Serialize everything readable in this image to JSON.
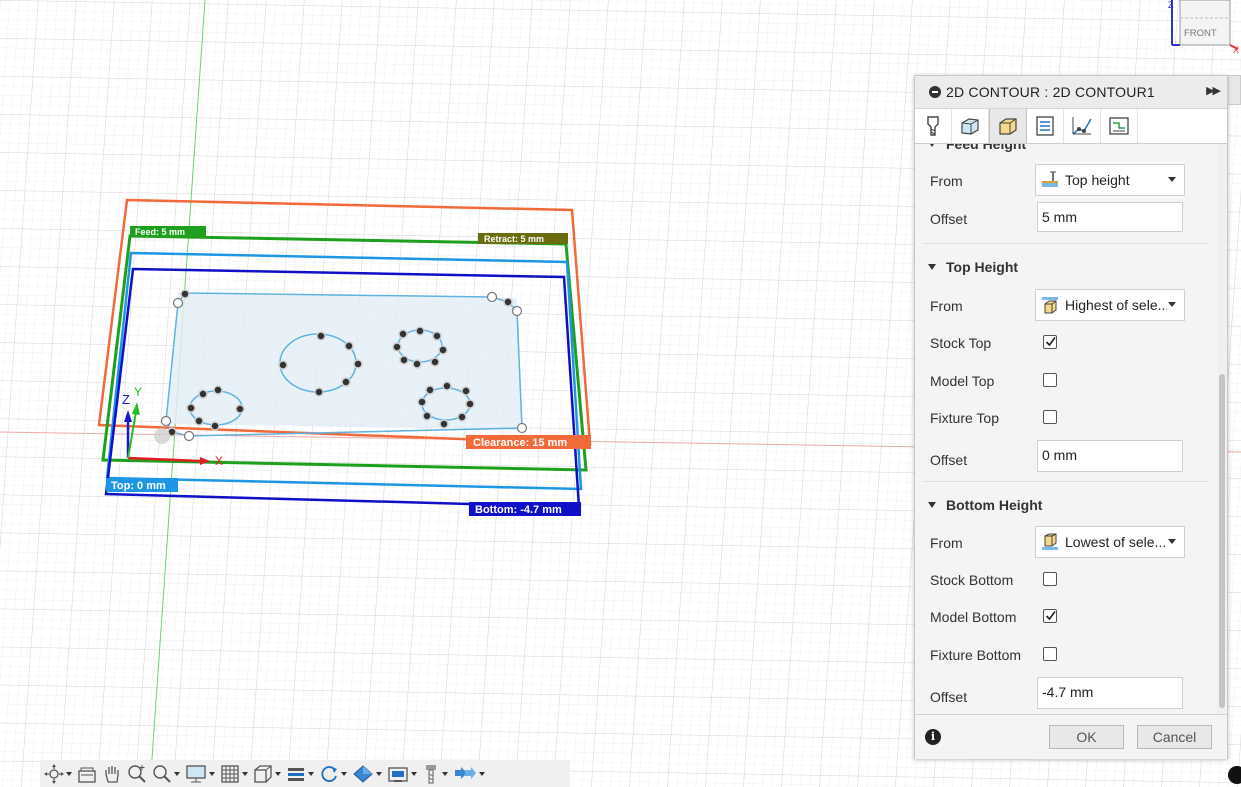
{
  "viewport": {
    "labels": {
      "feed": "Feed: 5 mm",
      "retract": "Retract: 5 mm",
      "clearance": "Clearance: 15 mm",
      "top": "Top: 0 mm",
      "bottom": "Bottom: -4.7 mm"
    },
    "axes": {
      "x": "X",
      "y": "Y",
      "z": "Z"
    },
    "colors": {
      "clearance": "#f26a3a",
      "feed": "#1ea01e",
      "retract": "#6b6b10",
      "top": "#1e96e6",
      "bottom": "#1010c8",
      "stock": "#7abde0"
    }
  },
  "viewcube": {
    "face": "FRONT",
    "axis_x": "X",
    "axis_z": "Z"
  },
  "panel": {
    "title": "2D CONTOUR : 2D CONTOUR1",
    "tabs": [
      {
        "name": "tool-tab",
        "icon": "tool-icon"
      },
      {
        "name": "geometry-tab",
        "icon": "geometry-icon"
      },
      {
        "name": "heights-tab",
        "icon": "heights-icon",
        "active": true
      },
      {
        "name": "passes-tab",
        "icon": "passes-icon"
      },
      {
        "name": "linking-tab",
        "icon": "linking-icon"
      },
      {
        "name": "shaft-tab",
        "icon": "shaft-holder-icon"
      }
    ],
    "feed_height": {
      "title": "Feed Height",
      "from_label": "From",
      "from_value": "Top height",
      "offset_label": "Offset",
      "offset_value": "5 mm"
    },
    "top_height": {
      "title": "Top Height",
      "from_label": "From",
      "from_value": "Highest of sele...",
      "stock_top_label": "Stock Top",
      "stock_top": true,
      "model_top_label": "Model Top",
      "model_top": false,
      "fixture_top_label": "Fixture Top",
      "fixture_top": false,
      "offset_label": "Offset",
      "offset_value": "0 mm"
    },
    "bottom_height": {
      "title": "Bottom Height",
      "from_label": "From",
      "from_value": "Lowest of sele...",
      "stock_bottom_label": "Stock Bottom",
      "stock_bottom": false,
      "model_bottom_label": "Model Bottom",
      "model_bottom": true,
      "fixture_bottom_label": "Fixture Bottom",
      "fixture_bottom": false,
      "offset_label": "Offset",
      "offset_value": "-4.7 mm"
    },
    "footer": {
      "ok": "OK",
      "cancel": "Cancel"
    }
  },
  "toolbar": [
    "orbit-icon",
    "home-icon",
    "pan-icon",
    "zoom-icon",
    "zoom-window-icon",
    "display-icon",
    "grid-icon",
    "view-icon",
    "section-icon",
    "rotate-icon",
    "appearance-icon",
    "camera-icon",
    "tool-icon",
    "simulate-icon"
  ]
}
